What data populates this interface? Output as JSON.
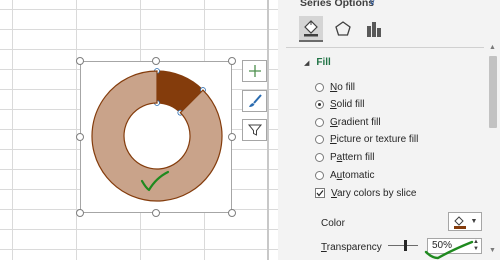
{
  "pane": {
    "title": "Series Options",
    "tabs": [
      {
        "icon": "paint-bucket-icon",
        "active": true
      },
      {
        "icon": "pentagon-effects-icon",
        "active": false
      },
      {
        "icon": "bar-chart-series-options-icon",
        "active": false
      }
    ],
    "section": "Fill",
    "fill_options": [
      {
        "label": "No fill",
        "accel": "N",
        "selected": false
      },
      {
        "label": "Solid fill",
        "accel": "S",
        "selected": true
      },
      {
        "label": "Gradient fill",
        "accel": "G",
        "selected": false
      },
      {
        "label": "Picture or texture fill",
        "accel": "P",
        "selected": false
      },
      {
        "label": "Pattern fill",
        "accel": "A",
        "selected": false
      },
      {
        "label": "Automatic",
        "accel": "U",
        "selected": false
      }
    ],
    "vary_colors": {
      "label": "Vary colors by slice",
      "checked": true
    },
    "color_label": "Color",
    "transparency_label": "Transparency",
    "transparency_value": "50%",
    "transparency_fraction": 0.5
  },
  "chart": {
    "type": "doughnut",
    "slice_fractions": [
      0.125,
      0.875
    ],
    "slice_colors": [
      "#843c0c",
      "#c9a38a"
    ],
    "selected_slice": 0,
    "outline_color": "#843c0c",
    "annotation_mark_color": "#1f8a1f"
  },
  "side_buttons": [
    {
      "icon": "plus-chart-elements-icon"
    },
    {
      "icon": "brush-chart-styles-icon"
    },
    {
      "icon": "funnel-chart-filters-icon"
    }
  ],
  "colors": {
    "pane_bg": "#f3f3f3",
    "fill_heading": "#217346",
    "checkmark_annotation": "#1f8a1f"
  }
}
